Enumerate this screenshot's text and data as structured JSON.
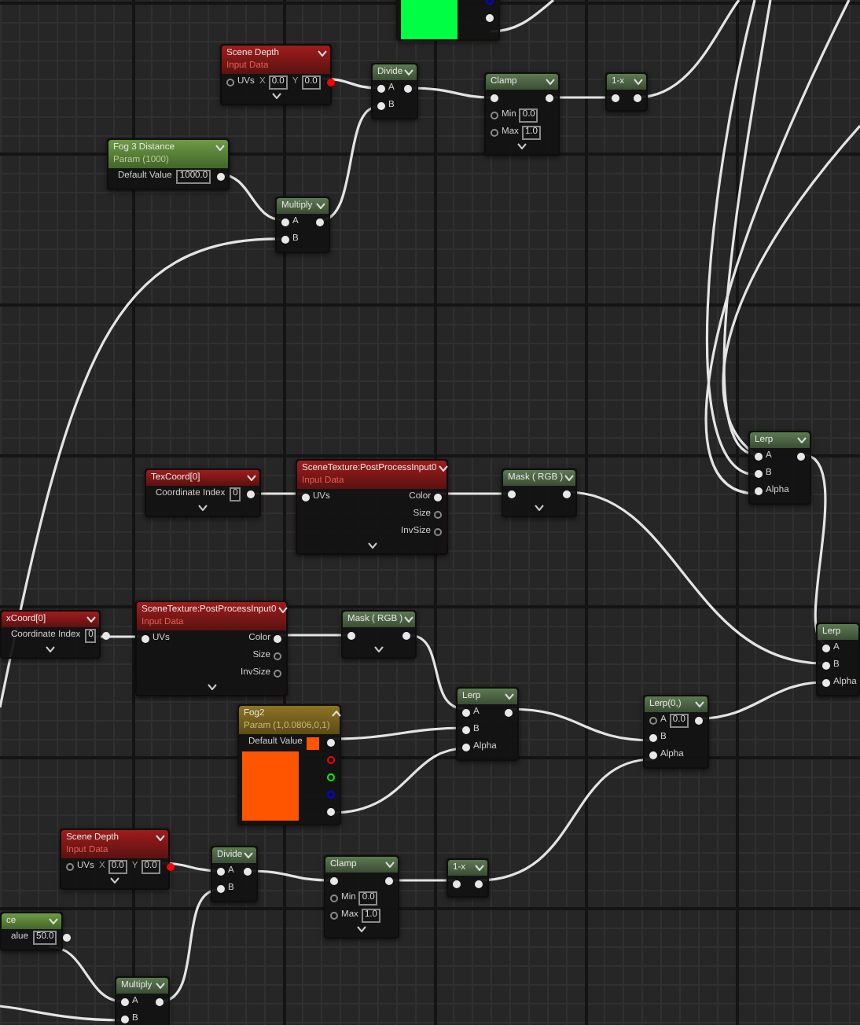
{
  "nodes": [
    {
      "kind": "vector_param",
      "advanced": false,
      "preview": {
        "color": "#00ff44",
        "rows": [
          {
            "output": {
              "connected": false,
              "color": "#0000ff"
            }
          },
          {
            "output": {
              "connected": true
            }
          }
        ]
      }
    },
    {
      "kind": "input",
      "title": "Scene Depth",
      "subtitle": "Input Data",
      "header_arrow": true,
      "advanced": true,
      "rows": [
        {
          "input": {
            "label": "UVs",
            "connected": false
          },
          "fields": [
            {
              "prefix": "X",
              "value": "0.0"
            },
            {
              "prefix": "Y",
              "value": "0.0"
            }
          ],
          "output": {
            "connected": true,
            "color": "#ff0000"
          }
        }
      ]
    },
    {
      "kind": "math",
      "title": "Divide",
      "header_arrow": true,
      "advanced": false,
      "rows": [
        {
          "input": {
            "label": "A",
            "connected": true
          },
          "output": {
            "connected": true
          }
        },
        {
          "input": {
            "label": "B",
            "connected": true
          }
        }
      ]
    },
    {
      "kind": "math",
      "title": "Clamp",
      "header_arrow": true,
      "advanced": true,
      "rows": [
        {
          "input": {
            "connected": true
          },
          "output": {
            "connected": true
          }
        },
        {
          "input": {
            "label": "Min",
            "connected": false
          },
          "fields": [
            {
              "value": "0.0"
            }
          ]
        },
        {
          "input": {
            "label": "Max",
            "connected": false
          },
          "fields": [
            {
              "value": "1.0"
            }
          ]
        }
      ]
    },
    {
      "kind": "math",
      "title": "1-x",
      "header_arrow": true,
      "advanced": false,
      "rows": [
        {
          "input": {
            "connected": true
          },
          "output": {
            "connected": true
          }
        }
      ]
    },
    {
      "kind": "scalar_param",
      "title": "Fog 3 Distance",
      "subtitle": "Param (1000)",
      "header_arrow": true,
      "advanced": false,
      "rows": [
        {
          "label": "Default Value",
          "fields": [
            {
              "value": "1000.0"
            }
          ],
          "output": {
            "connected": true
          }
        }
      ]
    },
    {
      "kind": "math",
      "title": "Multiply",
      "header_arrow": true,
      "advanced": false,
      "rows": [
        {
          "input": {
            "label": "A",
            "connected": true
          },
          "output": {
            "connected": true
          }
        },
        {
          "input": {
            "label": "B",
            "connected": true
          }
        }
      ]
    },
    {
      "kind": "input",
      "title": "TexCoord[0]",
      "header_arrow": true,
      "advanced": true,
      "rows": [
        {
          "label": "Coordinate Index",
          "fields": [
            {
              "value": "0"
            }
          ],
          "output": {
            "connected": true
          }
        }
      ]
    },
    {
      "kind": "input",
      "title": "SceneTexture:PostProcessInput0",
      "subtitle": "Input Data",
      "header_arrow": true,
      "advanced": true,
      "rows": [
        {
          "input": {
            "label": "UVs",
            "connected": true
          },
          "output": {
            "label": "Color",
            "connected": true
          }
        },
        {
          "output": {
            "label": "Size",
            "connected": false
          }
        },
        {
          "output": {
            "label": "InvSize",
            "connected": false
          }
        }
      ]
    },
    {
      "kind": "math",
      "title": "Mask ( RGB )",
      "header_arrow": true,
      "advanced": true,
      "rows": [
        {
          "input": {
            "connected": true
          },
          "output": {
            "connected": true
          }
        }
      ]
    },
    {
      "kind": "math",
      "title": "Lerp",
      "header_arrow": true,
      "advanced": false,
      "rows": [
        {
          "input": {
            "label": "A",
            "connected": true
          },
          "output": {
            "connected": true
          }
        },
        {
          "input": {
            "label": "B",
            "connected": true
          }
        },
        {
          "input": {
            "label": "Alpha",
            "connected": true
          }
        }
      ]
    },
    {
      "kind": "input",
      "title": "xCoord[0]",
      "header_arrow": true,
      "advanced": true,
      "rows": [
        {
          "label": "Coordinate Index",
          "fields": [
            {
              "value": "0"
            }
          ],
          "output": {
            "connected": true
          }
        }
      ]
    },
    {
      "kind": "input",
      "title": "SceneTexture:PostProcessInput0",
      "subtitle": "Input Data",
      "header_arrow": true,
      "advanced": true,
      "rows": [
        {
          "input": {
            "label": "UVs",
            "connected": true
          },
          "output": {
            "label": "Color",
            "connected": true
          }
        },
        {
          "output": {
            "label": "Size",
            "connected": false
          }
        },
        {
          "output": {
            "label": "InvSize",
            "connected": false
          }
        }
      ]
    },
    {
      "kind": "math",
      "title": "Mask ( RGB )",
      "header_arrow": true,
      "advanced": true,
      "rows": [
        {
          "input": {
            "connected": true
          },
          "output": {
            "connected": true
          }
        }
      ]
    },
    {
      "kind": "math",
      "title": "Lerp",
      "header_arrow": false,
      "advanced": false,
      "rows": [
        {
          "input": {
            "label": "A",
            "connected": true
          }
        },
        {
          "input": {
            "label": "B",
            "connected": true
          }
        },
        {
          "input": {
            "label": "Alpha",
            "connected": true
          }
        }
      ]
    },
    {
      "kind": "vector_param",
      "title": "Fog2",
      "subtitle": "Param (1,0.0806,0,1)",
      "header_arrow": true,
      "preview_expanded": true,
      "advanced": false,
      "rows": [
        {
          "label": "Default Value",
          "fields": [
            {
              "color": "#ff5500"
            }
          ],
          "output": {
            "connected": true
          }
        }
      ],
      "preview": {
        "color": "#ff5500",
        "rows": [
          {
            "output": {
              "connected": false,
              "color": "#ff0000"
            }
          },
          {
            "output": {
              "connected": false,
              "color": "#00ff00"
            }
          },
          {
            "output": {
              "connected": false,
              "color": "#0000ff"
            }
          },
          {
            "output": {
              "connected": true
            }
          }
        ]
      }
    },
    {
      "kind": "math",
      "title": "Lerp",
      "header_arrow": true,
      "advanced": false,
      "rows": [
        {
          "input": {
            "label": "A",
            "connected": true
          },
          "output": {
            "connected": true
          }
        },
        {
          "input": {
            "label": "B",
            "connected": true
          }
        },
        {
          "input": {
            "label": "Alpha",
            "connected": true
          }
        }
      ]
    },
    {
      "kind": "math",
      "title": "Lerp(0,)",
      "header_arrow": true,
      "advanced": false,
      "rows": [
        {
          "input": {
            "label": "A",
            "connected": false
          },
          "fields": [
            {
              "value": "0.0"
            }
          ],
          "output": {
            "connected": true
          }
        },
        {
          "input": {
            "label": "B",
            "connected": true
          }
        },
        {
          "input": {
            "label": "Alpha",
            "connected": true
          }
        }
      ]
    },
    {
      "kind": "input",
      "title": "Scene Depth",
      "subtitle": "Input Data",
      "header_arrow": true,
      "advanced": true,
      "rows": [
        {
          "input": {
            "label": "UVs",
            "connected": false
          },
          "fields": [
            {
              "prefix": "X",
              "value": "0.0"
            },
            {
              "prefix": "Y",
              "value": "0.0"
            }
          ],
          "output": {
            "connected": true,
            "color": "#ff0000"
          }
        }
      ]
    },
    {
      "kind": "math",
      "title": "Divide",
      "header_arrow": true,
      "advanced": false,
      "rows": [
        {
          "input": {
            "label": "A",
            "connected": true
          },
          "output": {
            "connected": true
          }
        },
        {
          "input": {
            "label": "B",
            "connected": true
          }
        }
      ]
    },
    {
      "kind": "math",
      "title": "Clamp",
      "header_arrow": true,
      "advanced": true,
      "rows": [
        {
          "input": {
            "connected": true
          },
          "output": {
            "connected": true
          }
        },
        {
          "input": {
            "label": "Min",
            "connected": false
          },
          "fields": [
            {
              "value": "0.0"
            }
          ]
        },
        {
          "input": {
            "label": "Max",
            "connected": false
          },
          "fields": [
            {
              "value": "1.0"
            }
          ]
        }
      ]
    },
    {
      "kind": "math",
      "title": "1-x",
      "header_arrow": true,
      "advanced": false,
      "rows": [
        {
          "input": {
            "connected": true
          },
          "output": {
            "connected": true
          }
        }
      ]
    },
    {
      "kind": "scalar_param",
      "title": "ce",
      "header_arrow": true,
      "advanced": false,
      "rows": [
        {
          "label": "alue",
          "fields": [
            {
              "value": "50.0"
            }
          ],
          "output": {
            "connected": true
          }
        }
      ]
    },
    {
      "kind": "math",
      "title": "Multiply",
      "header_arrow": true,
      "advanced": false,
      "rows": [
        {
          "input": {
            "label": "A",
            "connected": true
          },
          "output": {
            "connected": true
          }
        },
        {
          "input": {
            "label": "B",
            "connected": true
          }
        }
      ]
    }
  ]
}
